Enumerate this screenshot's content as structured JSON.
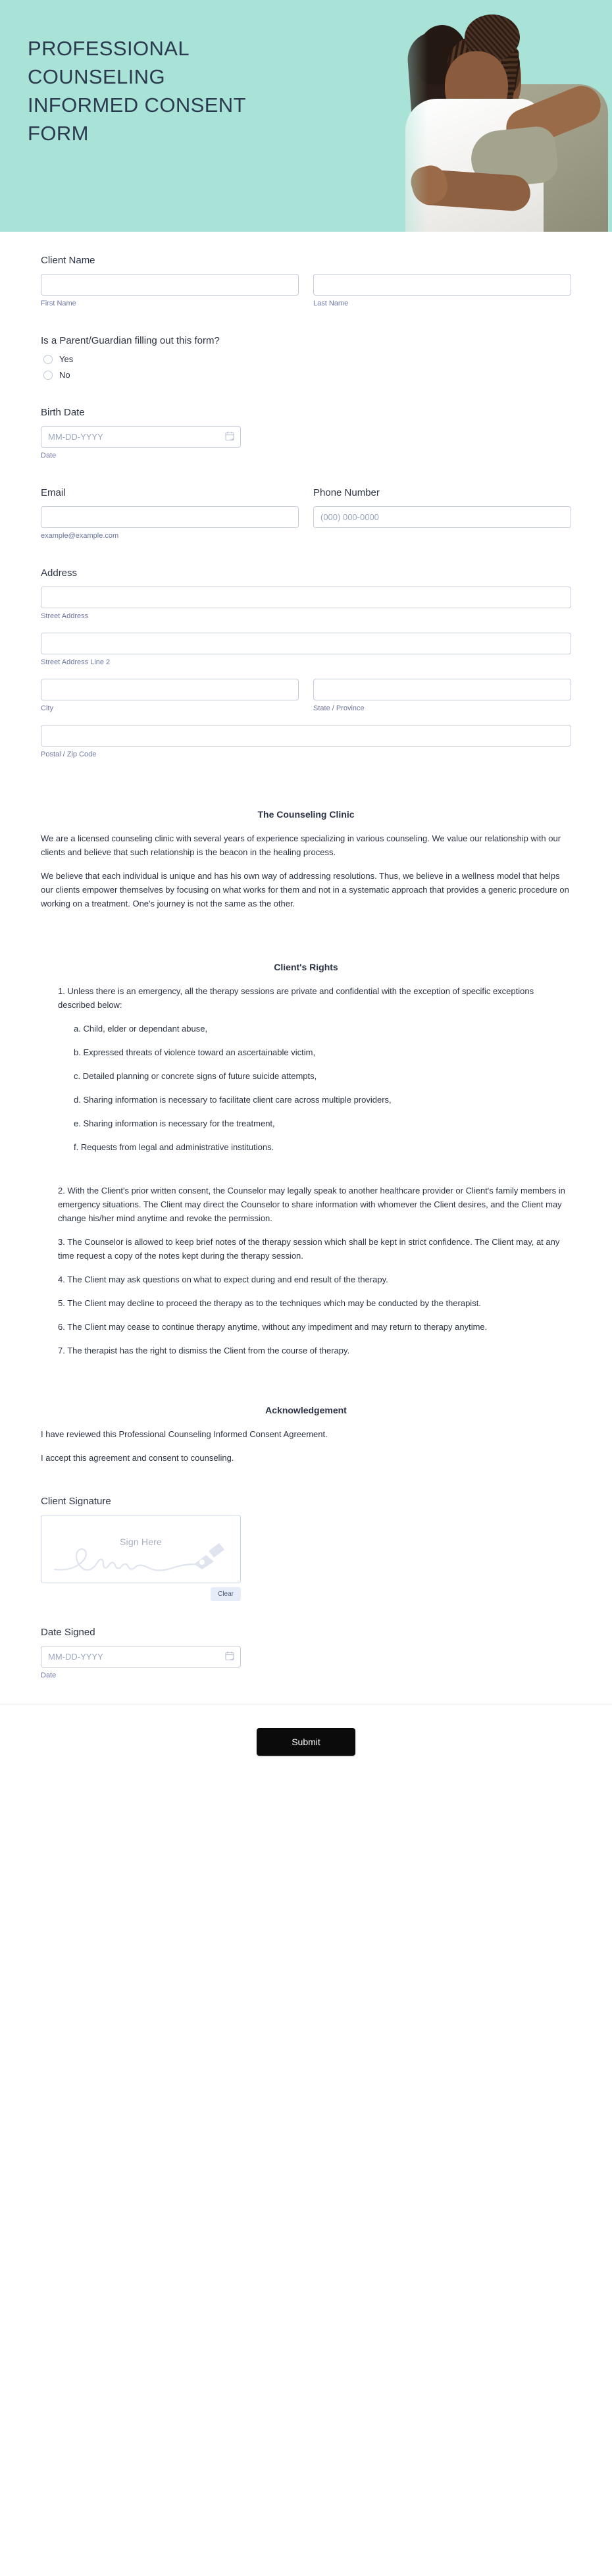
{
  "header": {
    "title": "PROFESSIONAL\nCOUNSELING\nINFORMED CONSENT\nFORM",
    "background_color": "#A9E2D6",
    "title_color": "#2B3A4F",
    "photo_alt": "two-women-hugging-photo"
  },
  "fields": {
    "client_name": {
      "label": "Client Name",
      "first": {
        "sublabel": "First Name",
        "value": "",
        "placeholder": ""
      },
      "last": {
        "sublabel": "Last Name",
        "value": "",
        "placeholder": ""
      }
    },
    "parent_guardian": {
      "label": "Is a Parent/Guardian filling out this form?",
      "options": [
        "Yes",
        "No"
      ],
      "selected": ""
    },
    "birth_date": {
      "label": "Birth Date",
      "placeholder": "MM-DD-YYYY",
      "value": "",
      "sublabel": "Date"
    },
    "email": {
      "label": "Email",
      "value": "",
      "placeholder": "",
      "sublabel": "example@example.com"
    },
    "phone": {
      "label": "Phone Number",
      "value": "",
      "placeholder": "(000) 000-0000",
      "sublabel": ""
    },
    "address": {
      "label": "Address",
      "street": {
        "sublabel": "Street Address",
        "value": ""
      },
      "street2": {
        "sublabel": "Street Address Line 2",
        "value": ""
      },
      "city": {
        "sublabel": "City",
        "value": ""
      },
      "state": {
        "sublabel": "State / Province",
        "value": ""
      },
      "postal": {
        "sublabel": "Postal / Zip Code",
        "value": ""
      }
    },
    "client_signature": {
      "label": "Client Signature",
      "placeholder": "Sign Here",
      "clear_label": "Clear"
    },
    "date_signed": {
      "label": "Date Signed",
      "placeholder": "MM-DD-YYYY",
      "value": "",
      "sublabel": "Date"
    }
  },
  "clinic": {
    "title": "The Counseling Clinic",
    "p1": "We are a licensed counseling clinic with several years of experience specializing in various counseling. We value our relationship with our clients and believe that such relationship is the beacon in the healing process.",
    "p2": "We believe that each individual is unique and has his own way of addressing resolutions. Thus, we believe in a wellness model that helps our clients empower themselves by focusing on what works for them and not in a systematic approach that provides a generic procedure on working on a treatment. One's journey is not the same as the other."
  },
  "rights": {
    "title": "Client's Rights",
    "item1": "1. Unless there is an emergency, all the therapy sessions are private and confidential with the exception of specific exceptions described below:",
    "sub_a": "a. Child, elder or dependant abuse,",
    "sub_b": "b. Expressed threats of violence toward an ascertainable victim,",
    "sub_c": "c. Detailed planning or concrete signs of future suicide attempts,",
    "sub_d": "d. Sharing information is necessary to facilitate client care across multiple providers,",
    "sub_e": "e. Sharing information is necessary for the treatment,",
    "sub_f": "f. Requests from legal and administrative institutions.",
    "item2": "2. With the Client's prior written consent, the Counselor may legally speak to another healthcare provider or Client's family members in emergency situations. The Client may direct the Counselor to share information with whomever the Client desires, and the Client may change his/her mind anytime and revoke the permission.",
    "item3": " 3. The Counselor is allowed to keep brief notes of the therapy session which shall be kept in strict confidence. The Client may, at any time request a copy of the notes kept during the therapy session.",
    "item4": "4. The Client may ask questions on what to expect during and end result of the therapy.",
    "item5": "5. The Client may decline to proceed the therapy as to the techniques which may be conducted by the therapist.",
    "item6": "6. The Client may cease to continue therapy anytime, without any impediment and may return to therapy anytime.",
    "item7": "7. The therapist has the right to dismiss the Client from the course of therapy."
  },
  "acknowledgement": {
    "title": "Acknowledgement",
    "p1": "I have reviewed this Professional Counseling Informed Consent Agreement.",
    "p2": "I accept this agreement and consent to counseling."
  },
  "submit": {
    "label": "Submit"
  }
}
